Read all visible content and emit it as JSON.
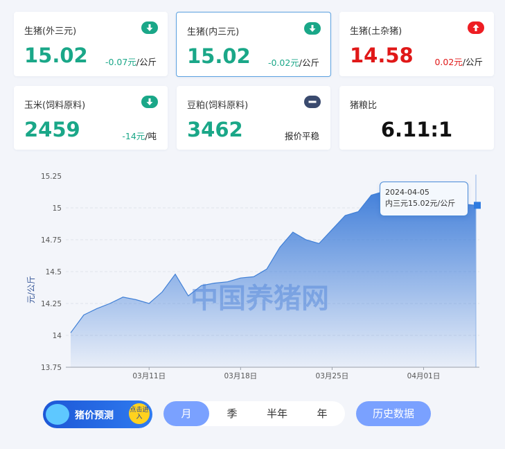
{
  "cards": [
    {
      "name": "生猪(外三元)",
      "value": "15.02",
      "change": "-0.07元",
      "unit": "/公斤",
      "trend": "down",
      "color": "#1aa788"
    },
    {
      "name": "生猪(内三元)",
      "value": "15.02",
      "change": "-0.02元",
      "unit": "/公斤",
      "trend": "down",
      "color": "#1aa788"
    },
    {
      "name": "生猪(土杂猪)",
      "value": "14.58",
      "change": "0.02元",
      "unit": "/公斤",
      "trend": "up",
      "color": "#e01818"
    },
    {
      "name": "玉米(饲料原料)",
      "value": "2459",
      "change": "-14元",
      "unit": "/吨",
      "trend": "down",
      "color": "#1aa788"
    },
    {
      "name": "豆粕(饲料原料)",
      "value": "3462",
      "status_text": "报价平稳",
      "trend": "flat",
      "color": "#1aa788"
    },
    {
      "name": "猪粮比",
      "value": "6.11:1"
    }
  ],
  "chart_data": {
    "type": "area",
    "ylabel": "元/公斤",
    "ylim": [
      13.75,
      15.25
    ],
    "yticks": [
      "15.25",
      "15",
      "14.75",
      "14.5",
      "14.25",
      "14",
      "13.75"
    ],
    "xtick_labels": [
      "03月11日",
      "03月18日",
      "03月25日",
      "04月01日"
    ],
    "watermark": "中国养猪网",
    "series": [
      {
        "values": [
          14.02,
          14.16,
          14.21,
          14.25,
          14.3,
          14.28,
          14.25,
          14.34,
          14.48,
          14.31,
          14.39,
          14.41,
          14.42,
          14.45,
          14.46,
          14.52,
          14.69,
          14.81,
          14.75,
          14.72,
          14.83,
          14.94,
          14.97,
          15.1,
          15.13,
          15.1,
          15.11,
          15.11,
          15.12,
          15.06,
          15.03,
          15.02
        ]
      }
    ],
    "grid": true,
    "highlight_index": 31
  },
  "tooltip": {
    "date": "2024-04-05",
    "text": "内三元15.02元/公斤"
  },
  "controls": {
    "forecast": "猪价预测",
    "forecast_go": "点击进入",
    "periods": [
      "月",
      "季",
      "半年",
      "年"
    ],
    "active_period": "月",
    "history": "历史数据"
  },
  "colors": {
    "accent": "#7aa1ff",
    "down": "#1aa788",
    "up": "#e01818",
    "line": "#3f7fd6"
  }
}
